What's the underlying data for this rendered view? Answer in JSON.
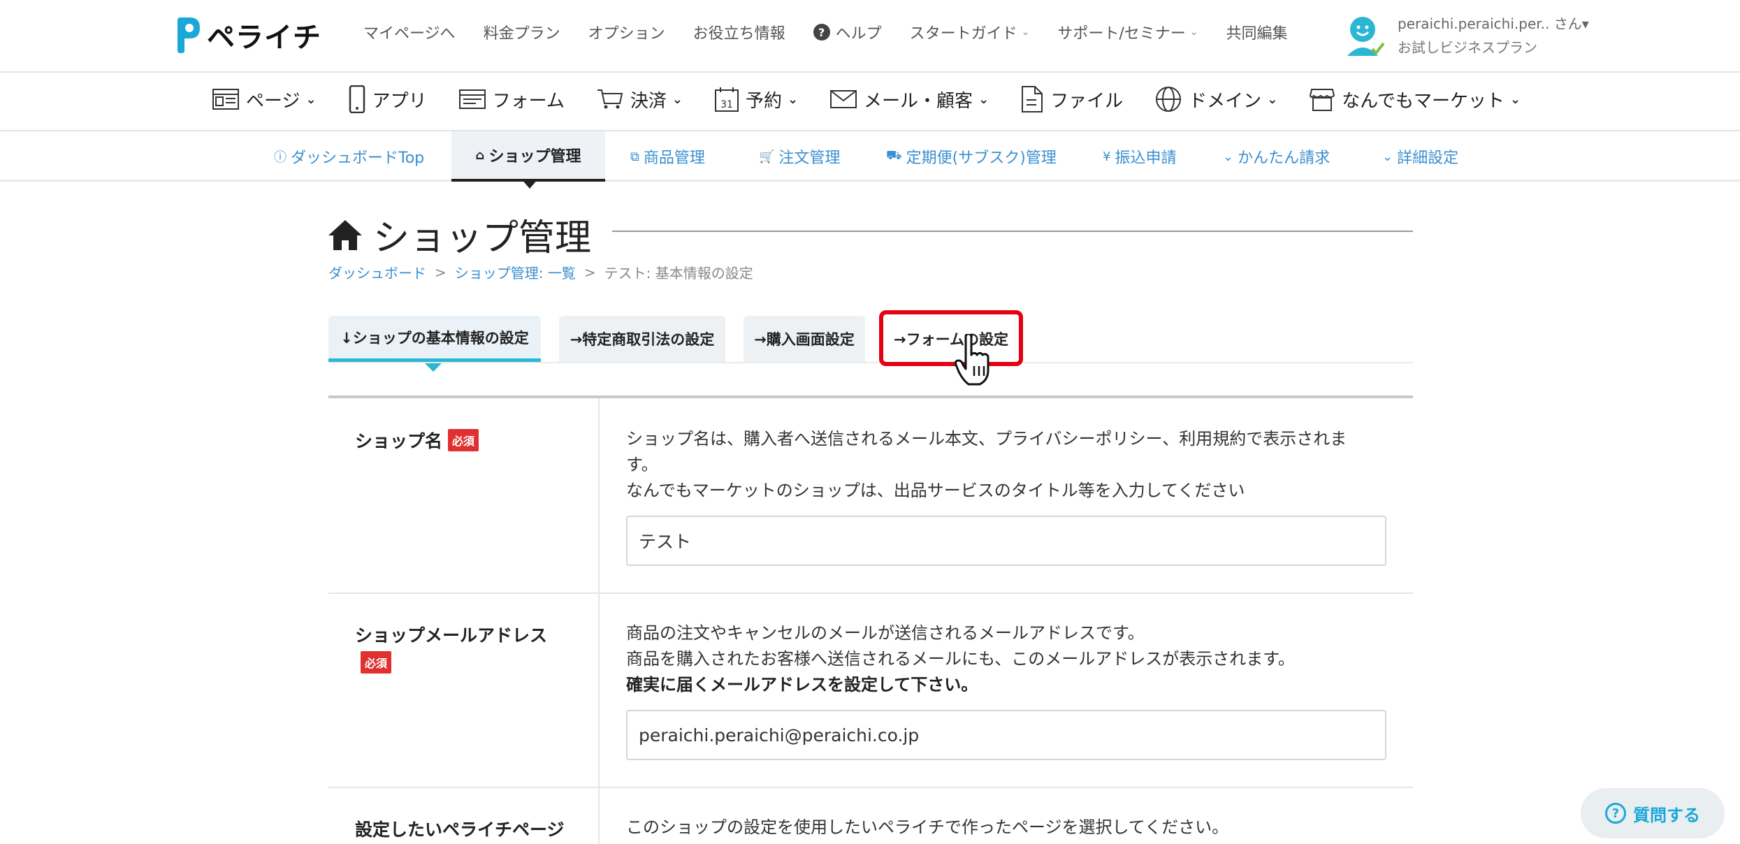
{
  "header": {
    "logo_text": "ペライチ",
    "nav": [
      {
        "label": "マイページへ"
      },
      {
        "label": "料金プラン"
      },
      {
        "label": "オプション"
      },
      {
        "label": "お役立ち情報"
      },
      {
        "label": "ヘルプ"
      },
      {
        "label": "スタートガイド"
      },
      {
        "label": "サポート/セミナー"
      },
      {
        "label": "共同編集"
      }
    ],
    "user_name": "peraichi.peraichi.per.. さん▾",
    "user_plan": "お試しビジネスプラン"
  },
  "main_nav": [
    {
      "label": "ページ",
      "icon": "page-icon"
    },
    {
      "label": "アプリ",
      "icon": "smartphone-icon"
    },
    {
      "label": "フォーム",
      "icon": "form-icon"
    },
    {
      "label": "決済",
      "icon": "cart-icon"
    },
    {
      "label": "予約",
      "icon": "calendar-icon"
    },
    {
      "label": "メール・顧客",
      "icon": "mail-icon"
    },
    {
      "label": "ファイル",
      "icon": "file-icon"
    },
    {
      "label": "ドメイン",
      "icon": "globe-icon"
    },
    {
      "label": "なんでもマーケット",
      "icon": "shop-icon"
    }
  ],
  "calendar_icon_text": "31",
  "sub_nav": [
    {
      "label": "ダッシュボードTop",
      "icon": "info-icon"
    },
    {
      "label": "ショップ管理",
      "icon": "home-icon"
    },
    {
      "label": "商品管理",
      "icon": "items-icon"
    },
    {
      "label": "注文管理",
      "icon": "cart-icon"
    },
    {
      "label": "定期便(サブスク)管理",
      "icon": "truck-icon"
    },
    {
      "label": "振込申請",
      "icon": "yen-icon"
    },
    {
      "label": "かんたん請求",
      "icon": "chevron-down-icon"
    },
    {
      "label": "詳細設定",
      "icon": "chevron-down-icon"
    }
  ],
  "page": {
    "title": "ショップ管理",
    "breadcrumb": [
      "ダッシュボード",
      "ショップ管理: 一覧",
      "テスト: 基本情報の設定"
    ],
    "breadcrumb_sep": ">"
  },
  "tabs": [
    {
      "label": "↓ショップの基本情報の設定"
    },
    {
      "label": "→特定商取引法の設定"
    },
    {
      "label": "→購入画面設定"
    },
    {
      "label": "→フォームの設定"
    }
  ],
  "form": {
    "required_label": "必須",
    "shop_name": {
      "label": "ショップ名",
      "desc_line1": "ショップ名は、購入者へ送信されるメール本文、プライバシーポリシー、利用規約で表示されま",
      "desc_line2": "す。",
      "desc_line3": "なんでもマーケットのショップは、出品サービスのタイトル等を入力してください",
      "value": "テスト"
    },
    "shop_email": {
      "label": "ショップメールアドレス",
      "desc_line1": "商品の注文やキャンセルのメールが送信されるメールアドレスです。",
      "desc_line2": "商品を購入されたお客様へ送信されるメールにも、このメールアドレスが表示されます。",
      "desc_strong": "確実に届くメールアドレスを設定して下さい。",
      "value": "peraichi.peraichi@peraichi.co.jp"
    },
    "page_select": {
      "label": "設定したいペライチページ",
      "desc_line1": "このショップの設定を使用したいペライチで作ったページを選択してください。"
    }
  },
  "help_button": {
    "label": "質問する",
    "icon_text": "?"
  },
  "colors": {
    "accent_blue": "#3a8fd0",
    "brand_cyan": "#1aa8d8",
    "tab_underline": "#2bb6d6",
    "required_red": "#e03030",
    "highlight_red": "#e50012"
  }
}
